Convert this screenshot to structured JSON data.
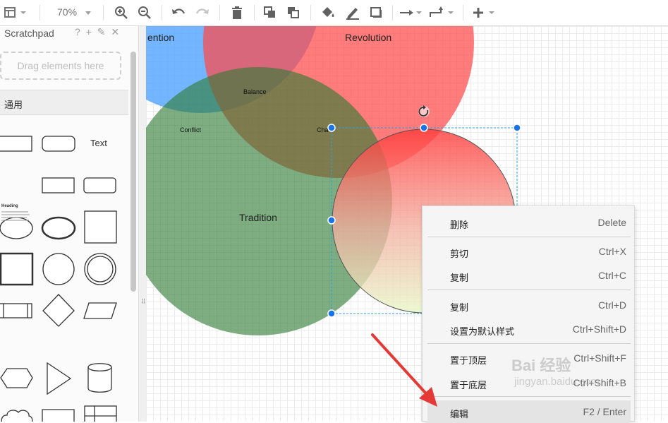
{
  "toolbar": {
    "zoom": "70%",
    "icons": [
      "layout-icon",
      "zoom-in-icon",
      "zoom-out-icon",
      "undo-icon",
      "redo-icon",
      "delete-icon",
      "to-front-icon",
      "to-back-icon",
      "fill-color-icon",
      "line-color-icon",
      "shadow-icon",
      "connection-icon",
      "waypoints-icon",
      "insert-icon"
    ]
  },
  "sidebar": {
    "scratchpad_title": "Scratchpad",
    "scratchpad_tools": "? + ✎ ✕",
    "drop_zone": "Drag elements here",
    "section_general": "通用",
    "text_shape": "Text",
    "heading_shape": "Heading"
  },
  "splitter": "⠿",
  "diagram": {
    "labels": {
      "revolution": "Revolution",
      "tradition": "Tradition",
      "balance": "Balance",
      "conflict": "Conflict",
      "change": "Cha",
      "partial": "ention"
    },
    "colors": {
      "red": "#ff5a5a",
      "blue": "#5aa8ff",
      "green": "#55915a",
      "selection": "#1a73e8"
    }
  },
  "context_menu": {
    "items": [
      {
        "label": "删除",
        "shortcut": "Delete"
      },
      {
        "label": "剪切",
        "shortcut": "Ctrl+X"
      },
      {
        "label": "复制",
        "shortcut": "Ctrl+C"
      },
      {
        "label": "复制",
        "shortcut": "Ctrl+D"
      },
      {
        "label": "设置为默认样式",
        "shortcut": "Ctrl+Shift+D"
      },
      {
        "label": "置于顶层",
        "shortcut": "Ctrl+Shift+F"
      },
      {
        "label": "置于底层",
        "shortcut": "Ctrl+Shift+B"
      },
      {
        "label": "编辑",
        "shortcut": "F2 / Enter"
      }
    ]
  },
  "watermark": {
    "text": "Bai 经验",
    "sub": "jingyan.baidu.com"
  }
}
